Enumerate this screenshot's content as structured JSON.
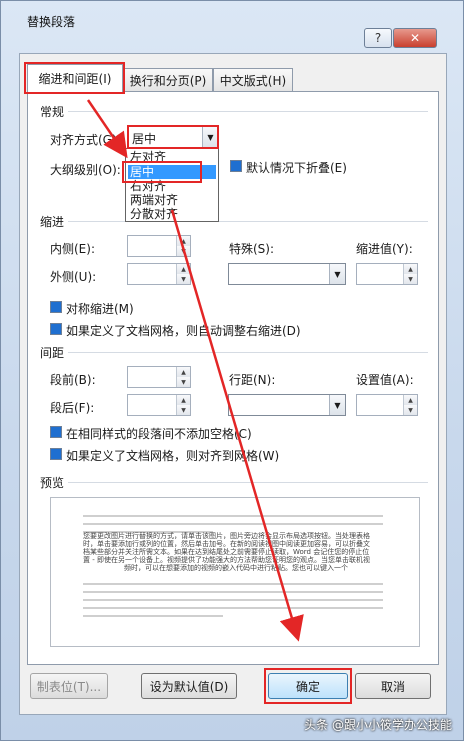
{
  "window": {
    "title": "替换段落",
    "help": "?",
    "close": "✕"
  },
  "tabs": [
    {
      "label": "缩进和间距(I)",
      "active": true
    },
    {
      "label": "换行和分页(P)",
      "active": false
    },
    {
      "label": "中文版式(H)",
      "active": false
    }
  ],
  "general": {
    "heading": "常规",
    "align_label": "对齐方式(G):",
    "align_value": "居中",
    "outline_label": "大纲级别(O):",
    "collapse_label": "默认情况下折叠(E)"
  },
  "align_options": [
    "左对齐",
    "居中",
    "右对齐",
    "两端对齐",
    "分散对齐"
  ],
  "indent": {
    "heading": "缩进",
    "inside_label": "内侧(E):",
    "outside_label": "外侧(U):",
    "special_label": "特殊(S):",
    "indent_by_label": "缩进值(Y):",
    "mirror_label": "对称缩进(M)",
    "auto_adjust_label": "如果定义了文档网格，则自动调整右缩进(D)"
  },
  "spacing": {
    "heading": "间距",
    "before_label": "段前(B):",
    "after_label": "段后(F):",
    "line_spacing_label": "行距(N):",
    "at_label": "设置值(A):",
    "no_space_label": "在相同样式的段落间不添加空格(C)",
    "snap_grid_label": "如果定义了文档网格，则对齐到网格(W)"
  },
  "preview": {
    "heading": "预览",
    "sample_lines": [
      "您要更改图片进行替换的方式，请单击该图片，图片旁边将会显示布局选项按钮。当处理表格",
      "时，单击要添加行或列的位置，然后单击加号。在新的阅读视图中阅读更加容易，可以折叠文",
      "档某些部分并关注所需文本。如果在达到结尾处之前需要停止读取，Word 会记住您的停止位",
      "置 - 即使在另一个设备上。视频提供了功能强大的方法帮助您证明您的观点。当您单击联机视",
      "频时，可以在想要添加的视频的嵌入代码中进行粘贴。您也可以键入一个"
    ]
  },
  "buttons": {
    "tabs_button": "制表位(T)...",
    "set_default": "设为默认值(D)",
    "ok": "确定",
    "cancel": "取消"
  },
  "watermark": "头条 @跟小小筱学办公技能",
  "colors": {
    "annotation": "#e32626",
    "selection": "#3399ff",
    "checkbox": "#1f6fd0"
  }
}
